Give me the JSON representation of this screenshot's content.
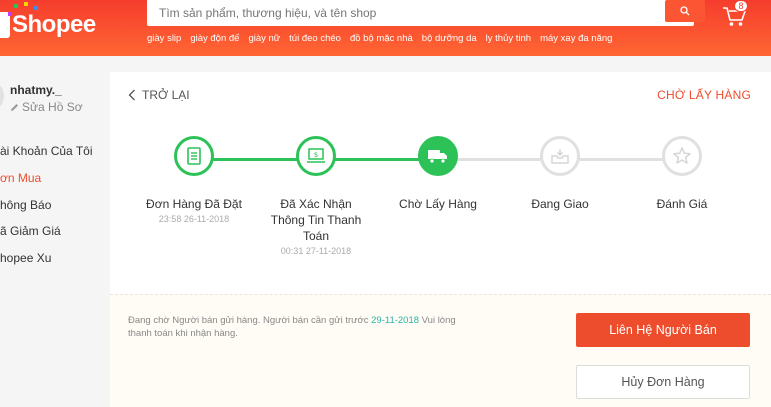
{
  "header": {
    "logo_text": "Shopee",
    "search_placeholder": "Tìm sản phẩm, thương hiệu, và tên shop",
    "cart_count": "8",
    "keywords": [
      "giày slip",
      "giày độn đế",
      "giày nữ",
      "túi đeo chéo",
      "đồ bộ mặc nhà",
      "bộ dưỡng da",
      "ly thủy tinh",
      "máy xay đa năng"
    ],
    "brand_color": "#f53d2d"
  },
  "sidebar": {
    "username": "nhatmy._",
    "edit_label": "Sửa Hồ Sơ",
    "menu": [
      {
        "label": "ài Khoản Của Tôi",
        "active": false
      },
      {
        "label": "ơn Mua",
        "active": true
      },
      {
        "label": "hông Báo",
        "active": false
      },
      {
        "label": "ã Giảm Giá",
        "active": false
      },
      {
        "label": "hopee Xu",
        "active": false
      }
    ]
  },
  "order": {
    "back_label": "TRỞ LẠI",
    "status_label": "CHỜ LẤY HÀNG",
    "steps": [
      {
        "label": "Đơn Hàng Đã Đặt",
        "time": "23:58 26-11-2018",
        "state": "done",
        "icon": "receipt-icon"
      },
      {
        "label": "Đã Xác Nhận Thông Tin Thanh Toán",
        "time": "00:31 27-11-2018",
        "state": "done",
        "icon": "money-icon"
      },
      {
        "label": "Chờ Lấy Hàng",
        "time": "",
        "state": "current",
        "icon": "truck-icon"
      },
      {
        "label": "Đang Giao",
        "time": "",
        "state": "todo",
        "icon": "inbox-icon"
      },
      {
        "label": "Đánh Giá",
        "time": "",
        "state": "todo",
        "icon": "star-icon"
      }
    ],
    "accent_green": "#2dc258"
  },
  "panel": {
    "message_pre": "Đang chờ Người bán gửi hàng. Người bán cần gửi trước ",
    "message_date": "29-11-2018",
    "message_post": " Vui lòng thanh toán khi nhận hàng.",
    "contact_button": "Liên Hệ Người Bán",
    "cancel_button": "Hủy Đơn Hàng"
  }
}
